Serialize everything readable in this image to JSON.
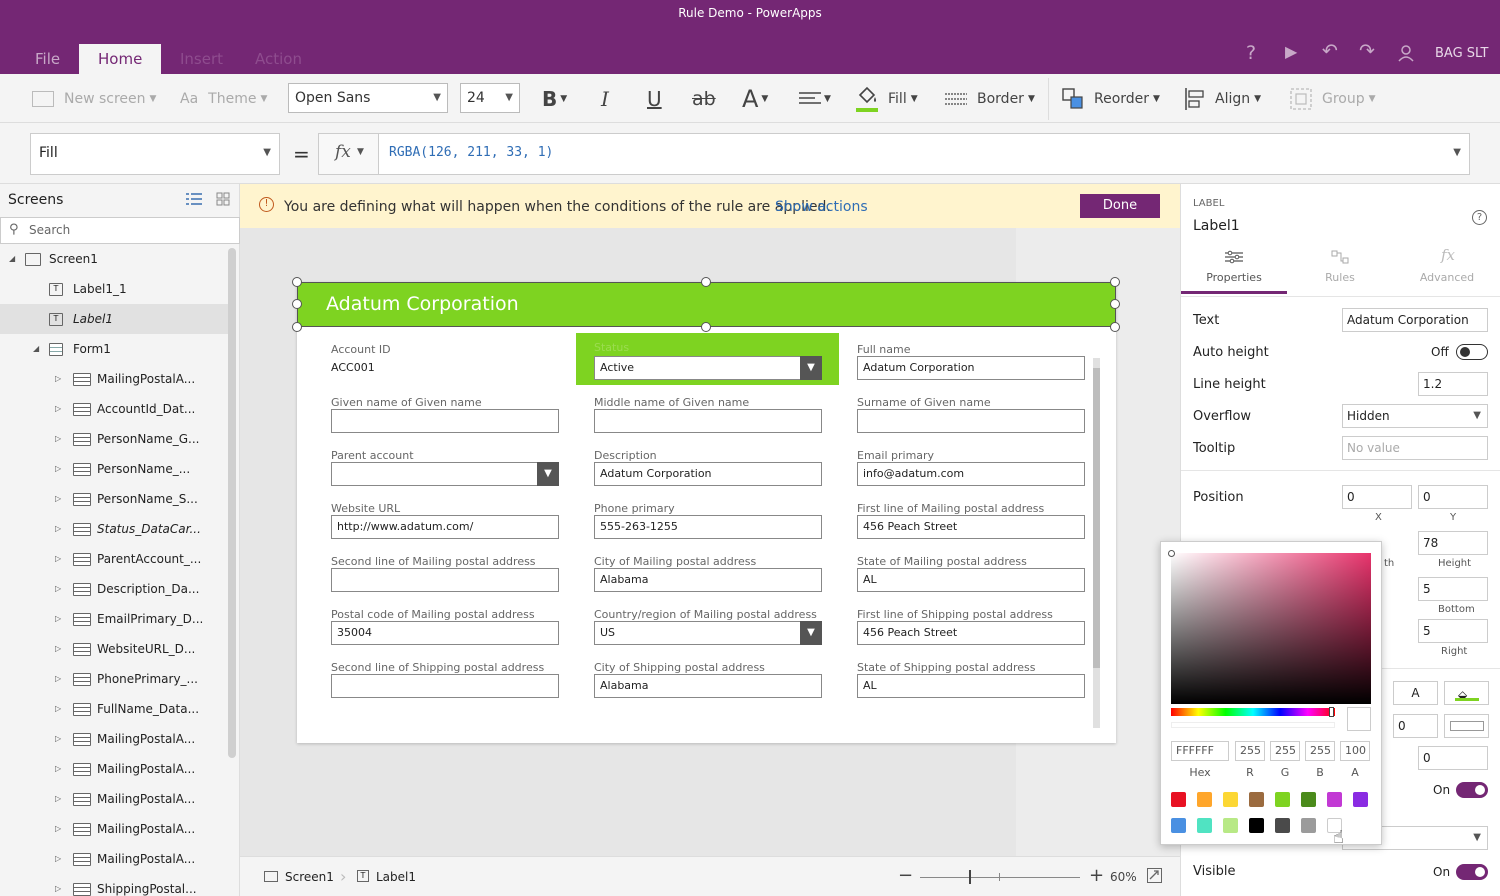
{
  "window": {
    "title": "Rule Demo - PowerApps"
  },
  "tabs": [
    {
      "label": "File"
    },
    {
      "label": "Home"
    },
    {
      "label": "Insert"
    },
    {
      "label": "Action"
    }
  ],
  "user": {
    "name": "BAG SLT"
  },
  "ribbon": {
    "new_screen": "New screen",
    "theme": "Theme",
    "font": "Open Sans",
    "font_size": "24",
    "bold": "B",
    "italic": "I",
    "underline": "U",
    "strike": "ab",
    "font_color": "A",
    "fill": "Fill",
    "border": "Border",
    "reorder": "Reorder",
    "align": "Align",
    "group": "Group"
  },
  "formula": {
    "property": "Fill",
    "equals": "=",
    "fx": "fx",
    "expression": "RGBA(126, 211, 33, 1)"
  },
  "left_panel": {
    "title": "Screens",
    "search_placeholder": "Search",
    "tree": [
      {
        "label": "Screen1"
      },
      {
        "label": "Label1_1"
      },
      {
        "label": "Label1"
      },
      {
        "label": "Form1"
      },
      {
        "label": "MailingPostalA..."
      },
      {
        "label": "AccountId_Dat..."
      },
      {
        "label": "PersonName_G..."
      },
      {
        "label": "PersonName_..."
      },
      {
        "label": "PersonName_S..."
      },
      {
        "label": "Status_DataCar..."
      },
      {
        "label": "ParentAccount_..."
      },
      {
        "label": "Description_Da..."
      },
      {
        "label": "EmailPrimary_D..."
      },
      {
        "label": "WebsiteURL_D..."
      },
      {
        "label": "PhonePrimary_..."
      },
      {
        "label": "FullName_Data..."
      },
      {
        "label": "MailingPostalA..."
      },
      {
        "label": "MailingPostalA..."
      },
      {
        "label": "MailingPostalA..."
      },
      {
        "label": "MailingPostalA..."
      },
      {
        "label": "MailingPostalA..."
      },
      {
        "label": "ShippingPostal..."
      }
    ]
  },
  "banner": {
    "message": "You are defining what will happen when the conditions of the rule are applied.",
    "link": "Show actions",
    "done": "Done"
  },
  "canvas": {
    "header_title": "Adatum Corporation",
    "header_color": "#7ed321",
    "fields": [
      {
        "label": "Account ID",
        "value": "ACC001",
        "type": "text"
      },
      {
        "label": "Status",
        "value": "Active",
        "type": "dropdown"
      },
      {
        "label": "Full name",
        "value": "Adatum Corporation",
        "type": "input"
      },
      {
        "label": "Given name of Given name",
        "value": "",
        "type": "input"
      },
      {
        "label": "Middle name of Given name",
        "value": "",
        "type": "input"
      },
      {
        "label": "Surname of Given name",
        "value": "",
        "type": "input"
      },
      {
        "label": "Parent account",
        "value": "",
        "type": "dropdown"
      },
      {
        "label": "Description",
        "value": "Adatum Corporation",
        "type": "input"
      },
      {
        "label": "Email primary",
        "value": "info@adatum.com",
        "type": "input"
      },
      {
        "label": "Website URL",
        "value": "http://www.adatum.com/",
        "type": "input"
      },
      {
        "label": "Phone primary",
        "value": "555-263-1255",
        "type": "input"
      },
      {
        "label": "First line of Mailing postal address",
        "value": "456 Peach Street",
        "type": "input"
      },
      {
        "label": "Second line of Mailing postal address",
        "value": "",
        "type": "input"
      },
      {
        "label": "City of Mailing postal address",
        "value": "Alabama",
        "type": "input"
      },
      {
        "label": "State of Mailing postal address",
        "value": "AL",
        "type": "input"
      },
      {
        "label": "Postal code of Mailing postal address",
        "value": "35004",
        "type": "input"
      },
      {
        "label": "Country/region of Mailing postal address",
        "value": "US",
        "type": "dropdown"
      },
      {
        "label": "First line of Shipping postal address",
        "value": "456 Peach Street",
        "type": "input"
      },
      {
        "label": "Second line of Shipping postal address",
        "value": "",
        "type": "input"
      },
      {
        "label": "City of Shipping postal address",
        "value": "Alabama",
        "type": "input"
      },
      {
        "label": "State of Shipping postal address",
        "value": "AL",
        "type": "input"
      }
    ]
  },
  "status_bar": {
    "screen": "Screen1",
    "control": "Label1",
    "zoom": "60%",
    "minus": "−",
    "plus": "+"
  },
  "right_panel": {
    "type": "LABEL",
    "name": "Label1",
    "tabs": [
      {
        "label": "Properties"
      },
      {
        "label": "Rules"
      },
      {
        "label": "Advanced"
      }
    ],
    "text_label": "Text",
    "text_value": "Adatum Corporation",
    "auto_height_label": "Auto height",
    "auto_height_value": "Off",
    "line_height_label": "Line height",
    "line_height_value": "1.2",
    "overflow_label": "Overflow",
    "overflow_value": "Hidden",
    "tooltip_label": "Tooltip",
    "tooltip_placeholder": "No value",
    "position_label": "Position",
    "pos_x": "0",
    "pos_y": "0",
    "x_lbl": "X",
    "y_lbl": "Y",
    "height_value": "78",
    "width_lbl": "th",
    "height_lbl": "Height",
    "pad_bottom": "5",
    "pad_bottom_lbl": "Bottom",
    "pad_right": "5",
    "pad_right_lbl": "Right",
    "border_value": "0",
    "border_value2": "0",
    "font_a": "A",
    "on1": "On",
    "visible_label": "Visible",
    "visible_value": "On"
  },
  "color_picker": {
    "hex": "FFFFFF",
    "r": "255",
    "g": "255",
    "b": "255",
    "a": "100",
    "hex_lbl": "Hex",
    "r_lbl": "R",
    "g_lbl": "G",
    "b_lbl": "B",
    "a_lbl": "A",
    "swatches": [
      "#e81123",
      "#ffa62b",
      "#fcd734",
      "#9b6b3f",
      "#7ed321",
      "#4b8b1b",
      "#c239d4",
      "#8a2be2",
      "#4a90e2",
      "#50e3c2",
      "#b8e986",
      "#000000",
      "#4a4a4a",
      "#9b9b9b",
      "#ffffff"
    ]
  }
}
